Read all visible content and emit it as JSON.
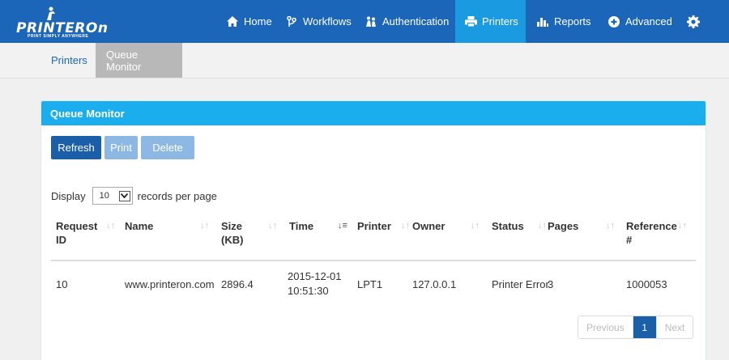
{
  "brand": {
    "name": "PRINTEROn",
    "tagline": "PRINT SIMPLY ANYWHERE"
  },
  "nav": {
    "items": [
      {
        "label": "Home",
        "icon": "home-icon"
      },
      {
        "label": "Workflows",
        "icon": "workflow-icon"
      },
      {
        "label": "Authentication",
        "icon": "people-icon"
      },
      {
        "label": "Printers",
        "icon": "printer-icon",
        "active": true
      },
      {
        "label": "Reports",
        "icon": "bar-chart-icon"
      },
      {
        "label": "Advanced",
        "icon": "plus-circle-icon"
      }
    ],
    "settings_icon": "gear-icon"
  },
  "subnav": {
    "items": [
      {
        "label": "Printers"
      },
      {
        "label": "Queue Monitor",
        "active": true
      }
    ]
  },
  "panel": {
    "title": "Queue Monitor",
    "buttons": {
      "refresh": "Refresh",
      "print": "Print",
      "delete": "Delete"
    },
    "display": {
      "prefix": "Display",
      "value": "10",
      "suffix": "records per page"
    }
  },
  "table": {
    "columns": [
      {
        "line1": "Request",
        "line2": "ID"
      },
      {
        "line1": "Name",
        "line2": ""
      },
      {
        "line1": "Size",
        "line2": "(KB)"
      },
      {
        "line1": "Time",
        "line2": ""
      },
      {
        "line1": "Printer",
        "line2": ""
      },
      {
        "line1": "Owner",
        "line2": ""
      },
      {
        "line1": "Status",
        "line2": ""
      },
      {
        "line1": "Pages",
        "line2": ""
      },
      {
        "line1": "Reference",
        "line2": "#"
      }
    ],
    "rows": [
      {
        "request_id": "10",
        "name": "www.printeron.com",
        "size": "2896.4",
        "time_date": "2015-12-01",
        "time_clock": "10:51:30",
        "printer": "LPT1",
        "owner": "127.0.0.1",
        "status": "Printer Error",
        "pages": "3",
        "reference": "1000053"
      }
    ]
  },
  "pagination": {
    "previous": "Previous",
    "current": "1",
    "next": "Next"
  },
  "colors": {
    "navbar": "#1b66b8",
    "active_nav": "#1a9ae0",
    "panel_header": "#1aaeef",
    "primary_button": "#1b5fa8",
    "disabled_button": "#8db8e3"
  }
}
